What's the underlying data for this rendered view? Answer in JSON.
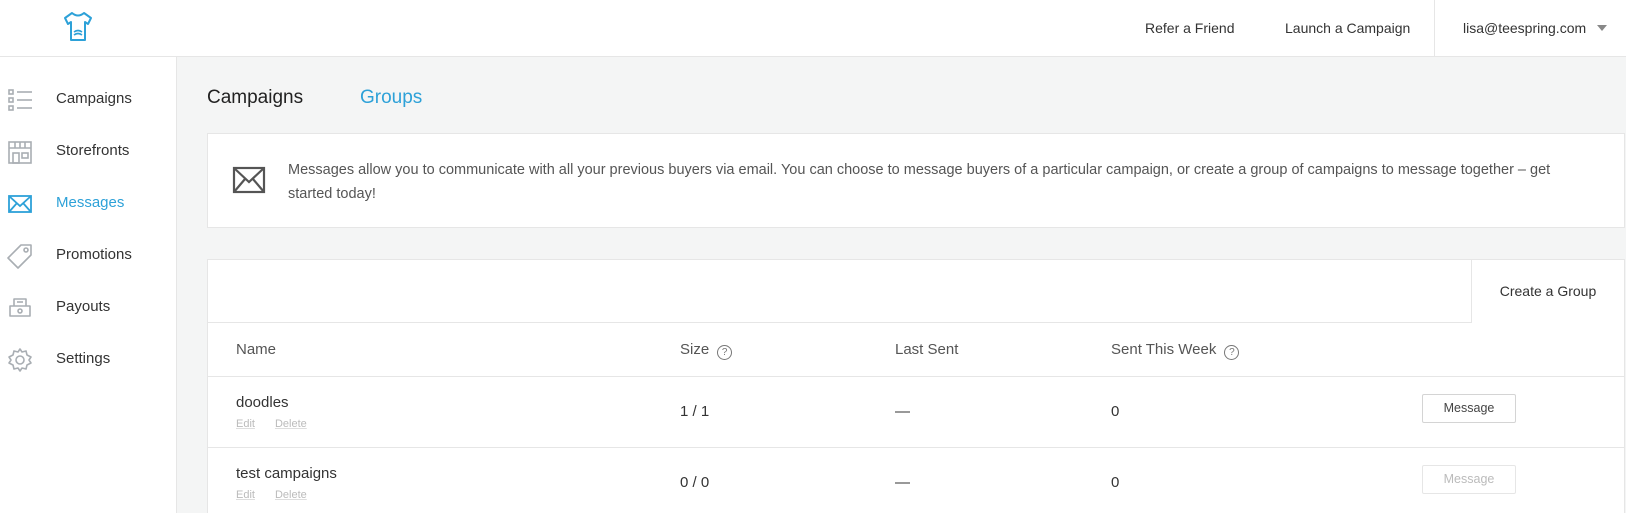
{
  "header": {
    "logo_icon": "tshirt-logo-icon",
    "nav": {
      "refer": "Refer a Friend",
      "launch": "Launch a Campaign"
    },
    "account_email": "lisa@teespring.com"
  },
  "sidebar": {
    "items": [
      {
        "label": "Campaigns",
        "icon": "list-icon",
        "active": false
      },
      {
        "label": "Storefronts",
        "icon": "storefront-icon",
        "active": false
      },
      {
        "label": "Messages",
        "icon": "envelope-icon",
        "active": true
      },
      {
        "label": "Promotions",
        "icon": "tag-icon",
        "active": false
      },
      {
        "label": "Payouts",
        "icon": "payout-icon",
        "active": false
      },
      {
        "label": "Settings",
        "icon": "gear-icon",
        "active": false
      }
    ]
  },
  "main": {
    "tabs": [
      {
        "label": "Campaigns",
        "active": true
      },
      {
        "label": "Groups",
        "active": false
      }
    ],
    "info": {
      "icon": "envelope-icon",
      "text": "Messages allow you to communicate with all your previous buyers via email. You can choose to message buyers of a particular campaign, or create a group of campaigns to message together – get started today!"
    },
    "create_group_label": "Create a Group",
    "table": {
      "columns": {
        "name": "Name",
        "size": "Size",
        "last_sent": "Last Sent",
        "sent_this_week": "Sent This Week"
      },
      "help_icon": "?",
      "rows": [
        {
          "name": "doodles",
          "edit": "Edit",
          "delete": "Delete",
          "size": "1 / 1",
          "last_sent": "—",
          "sent_this_week": "0",
          "action": "Message",
          "action_enabled": true
        },
        {
          "name": "test campaigns",
          "edit": "Edit",
          "delete": "Delete",
          "size": "0 / 0",
          "last_sent": "—",
          "sent_this_week": "0",
          "action": "Message",
          "action_enabled": false
        }
      ]
    }
  },
  "colors": {
    "accent": "#2da1d8",
    "background": "#f4f5f5",
    "border": "#e6e6e6"
  }
}
